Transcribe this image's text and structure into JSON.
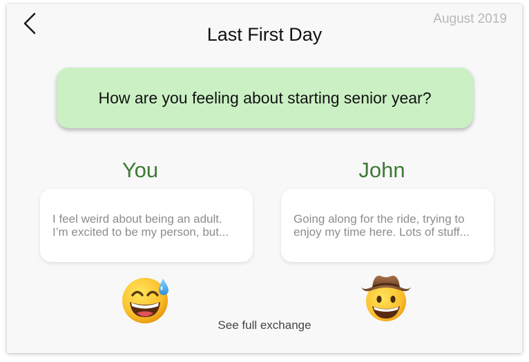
{
  "header": {
    "title": "Last First Day",
    "date": "August 2019",
    "back_icon": "chevron-left-icon"
  },
  "prompt": {
    "question": "How are you feeling about starting senior year?",
    "background": "#cbf0c4"
  },
  "participants": [
    {
      "name": "You",
      "answer_line1": "I feel weird about being an adult.",
      "answer_line2": "I’m excited to be my person, but...",
      "emoji": "grinning-face-with-sweat-icon"
    },
    {
      "name": "John",
      "answer_line1": "Going along for the ride, trying to",
      "answer_line2": "enjoy my time here. Lots of stuff...",
      "emoji": "cowboy-hat-face-icon"
    }
  ],
  "footer": {
    "link_label": "See full exchange"
  },
  "colors": {
    "accent_green": "#3d7a35",
    "muted_text": "#8c8c8c",
    "date_text": "#b7b7b7"
  }
}
